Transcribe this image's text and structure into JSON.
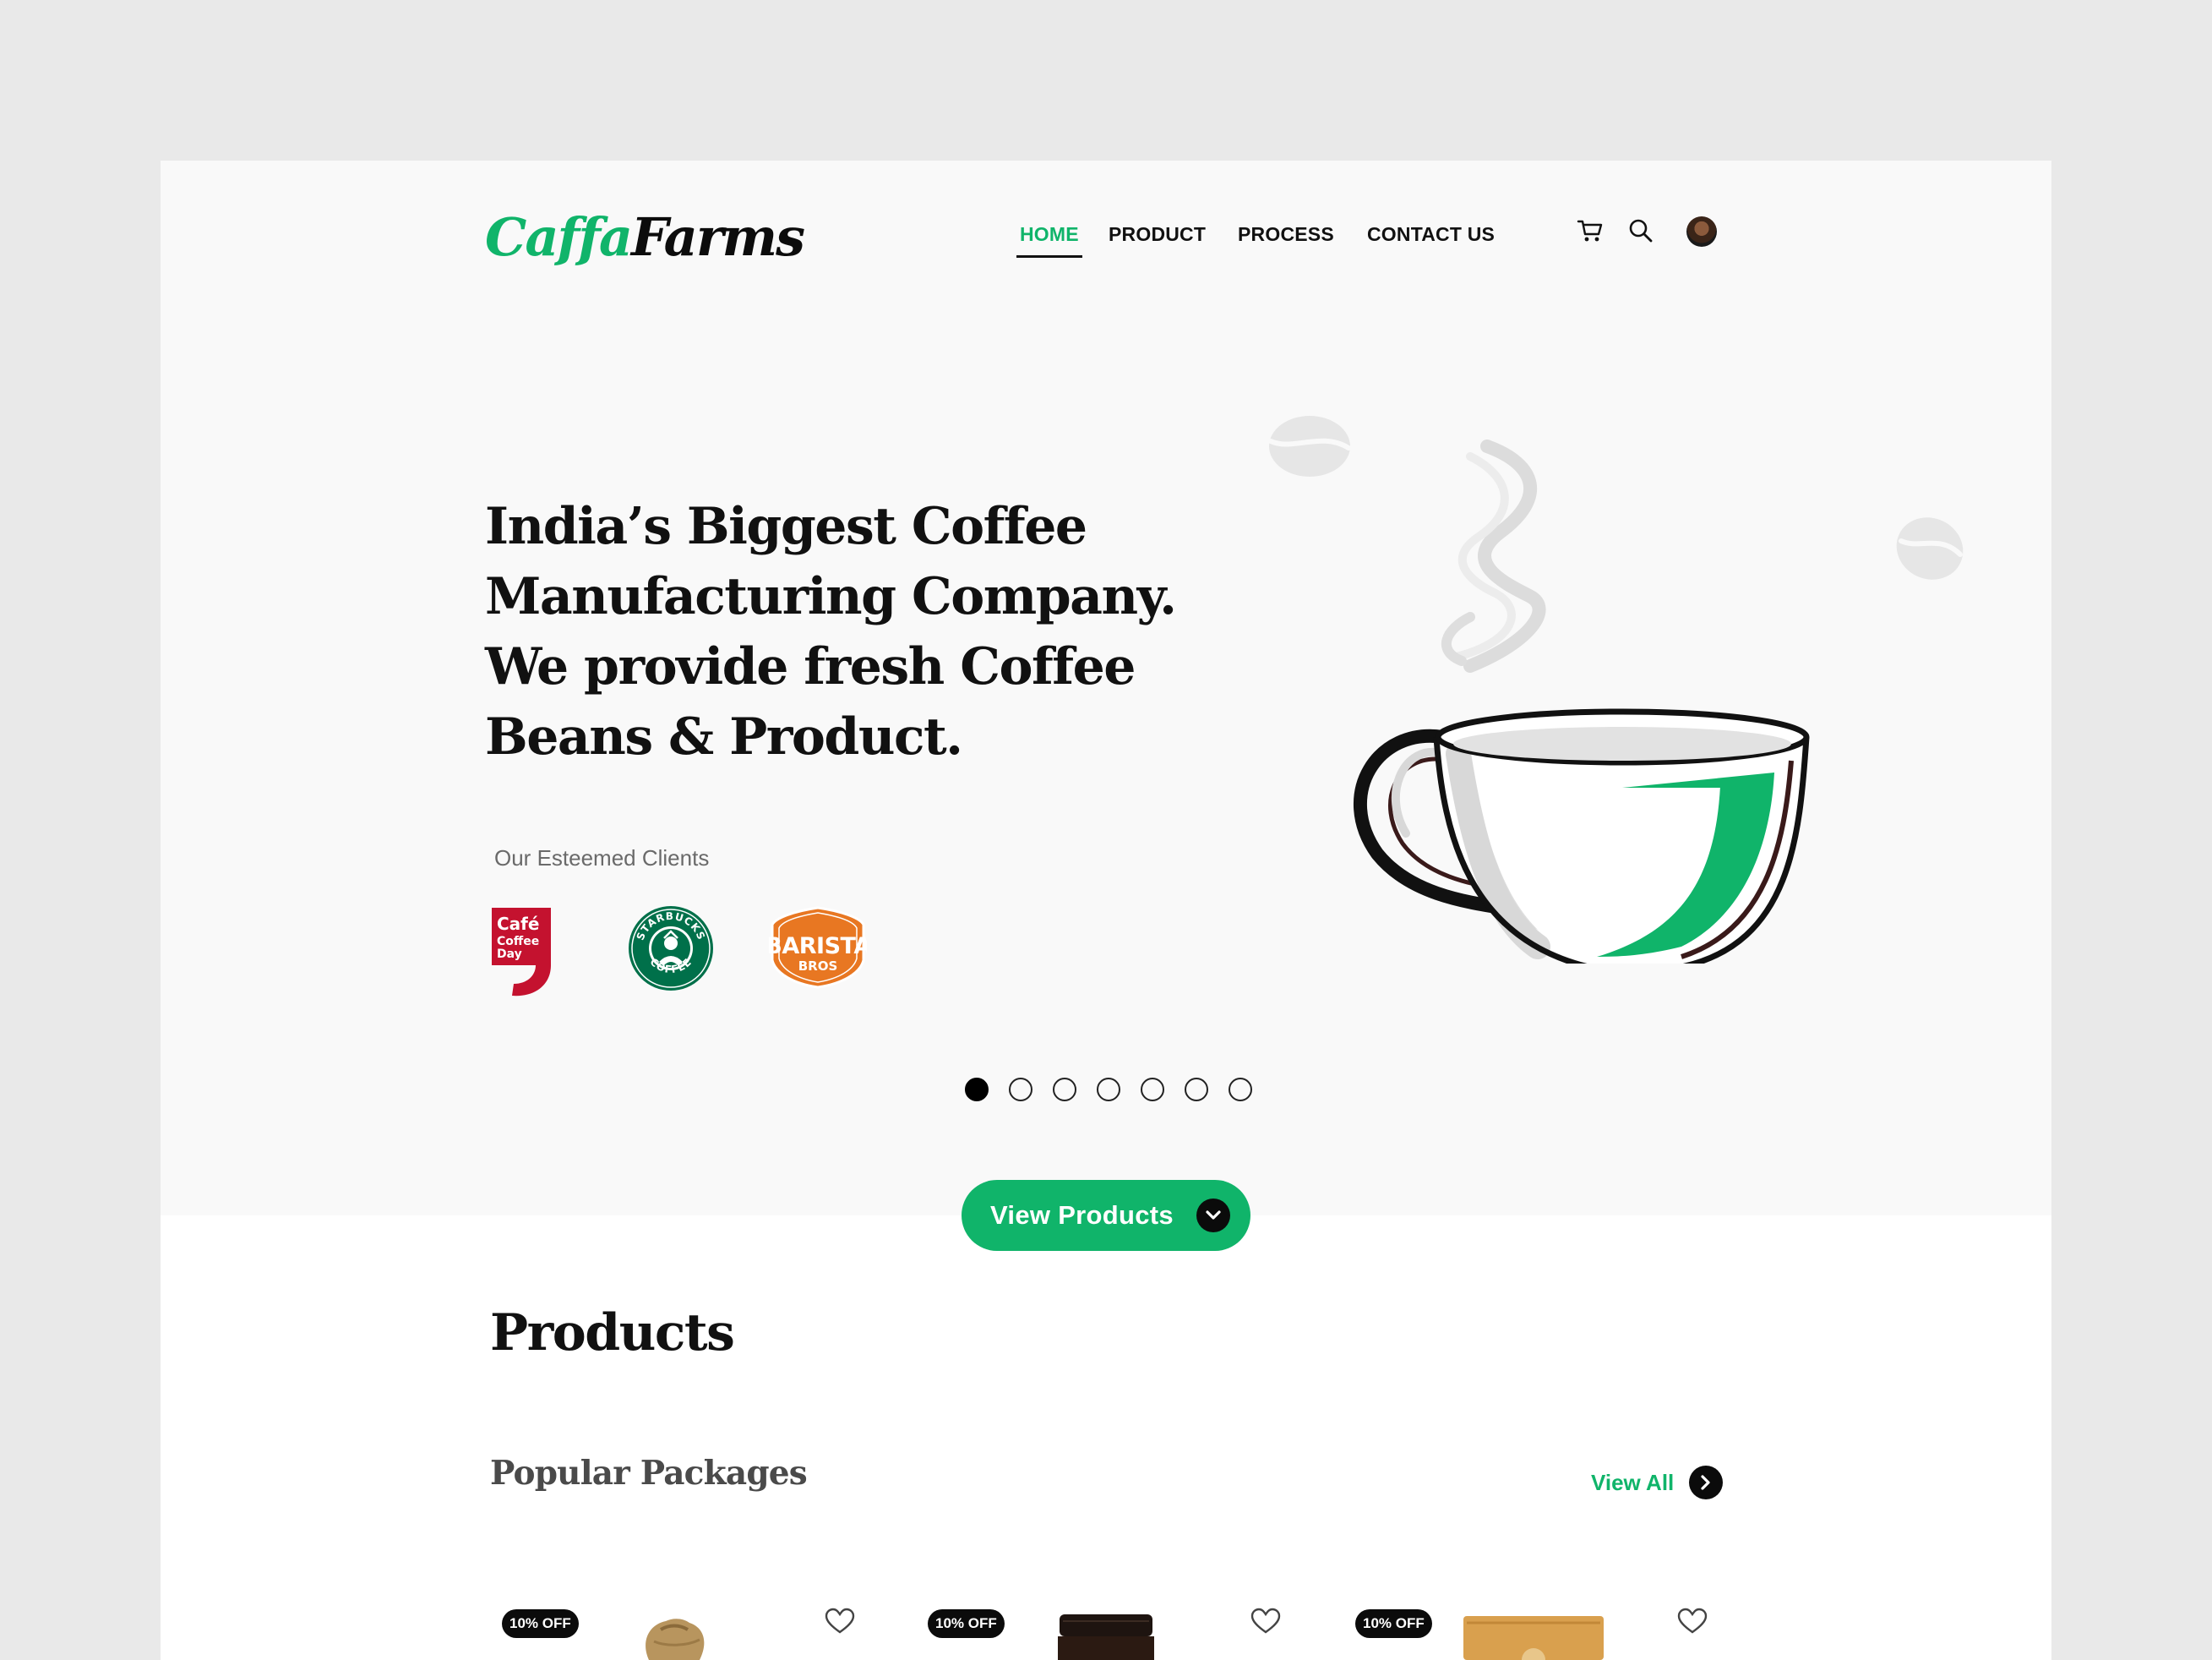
{
  "brand": {
    "logo_part1": "Caffa",
    "logo_part2": "Farms"
  },
  "nav": {
    "items": [
      {
        "label": "HOME",
        "active": true
      },
      {
        "label": "PRODUCT",
        "active": false
      },
      {
        "label": "PROCESS",
        "active": false
      },
      {
        "label": "CONTACT US",
        "active": false
      }
    ]
  },
  "header_icons": [
    "cart-icon",
    "search-icon",
    "avatar"
  ],
  "hero": {
    "headline": "India’s Biggest Coffee Manufacturing Company. We provide fresh Coffee Beans & Product.",
    "clients_label": "Our Esteemed Clients",
    "clients": [
      {
        "name": "Café Coffee Day",
        "logo_text": [
          "Café",
          "Coffee",
          "Day"
        ]
      },
      {
        "name": "Starbucks",
        "logo_text": [
          "STARBUCKS",
          "COFFEE"
        ]
      },
      {
        "name": "Barista",
        "logo_text": [
          "BARISTA",
          "BROS"
        ]
      }
    ],
    "carousel": {
      "total": 7,
      "active": 1
    },
    "cta_label": "View Products"
  },
  "products": {
    "title": "Products",
    "subtitle": "Popular Packages",
    "view_all_label": "View All",
    "cards": [
      {
        "badge": "10% OFF",
        "image": "jute-sack"
      },
      {
        "badge": "10% OFF",
        "image": "coffee-jar"
      },
      {
        "badge": "10% OFF",
        "image": "coffee-pouch"
      }
    ]
  },
  "colors": {
    "accent": "#10b46a",
    "dark": "#0b0b0b",
    "hero_bg": "#f9f9f9",
    "page_bg": "#e9e9e9"
  }
}
